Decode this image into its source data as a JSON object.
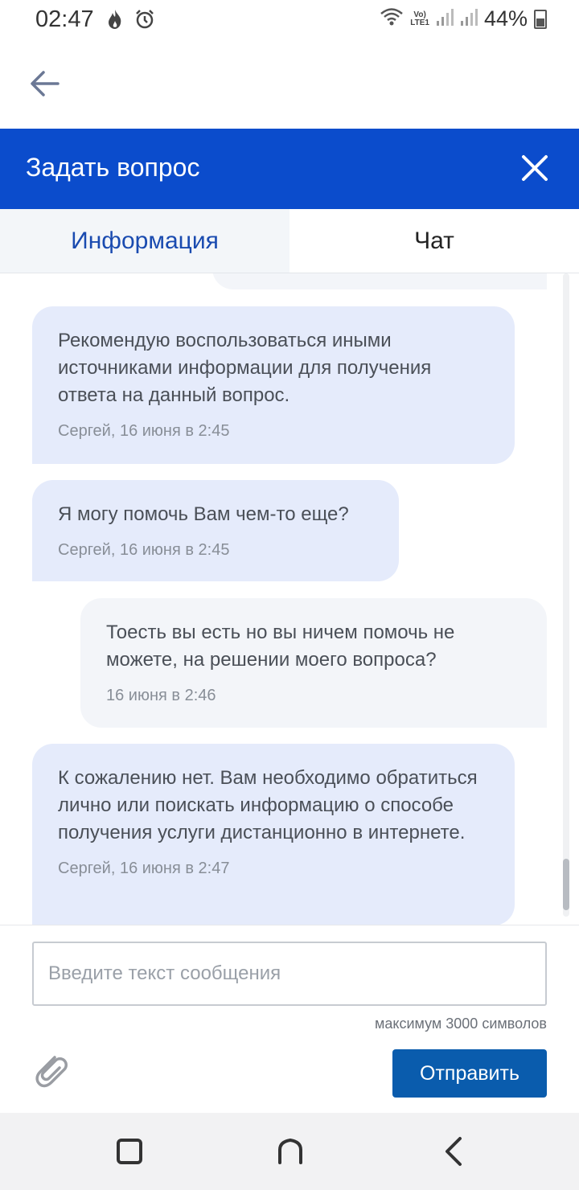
{
  "status_bar": {
    "time": "02:47",
    "battery": "44%",
    "network_label_top": "Vo)",
    "network_label_bottom": "LTE1",
    "icons": [
      "flame-icon",
      "alarm-icon",
      "wifi-icon",
      "signal-icon",
      "battery-icon"
    ]
  },
  "header": {
    "title": "Задать вопрос",
    "background_color": "#0b4ccc"
  },
  "tabs": [
    {
      "label": "Информация",
      "active": false
    },
    {
      "label": "Чат",
      "active": true
    }
  ],
  "messages": [
    {
      "from": "operator",
      "text": "Рекомендую воспользоваться иными источниками информации для получения ответа на данный вопрос.",
      "meta": "Сергей, 16 июня в 2:45"
    },
    {
      "from": "operator",
      "text": "Я могу помочь Вам чем-то еще?",
      "meta": "Сергей, 16 июня в 2:45"
    },
    {
      "from": "user",
      "text": "Тоесть вы есть но вы ничем помочь не можете, на решении моего вопроса?",
      "meta": "16 июня в 2:46"
    },
    {
      "from": "operator",
      "text": "К сожалению нет. Вам необходимо обратиться лично или поискать информацию о способе получения услуги дистанционно в интернете.",
      "meta": "Сергей, 16 июня в 2:47"
    }
  ],
  "composer": {
    "placeholder": "Введите текст сообщения",
    "value": "",
    "max_chars_label": "максимум 3000 символов",
    "send_label": "Отправить"
  },
  "colors": {
    "accent": "#0b4ccc",
    "send_button": "#0a5cad",
    "operator_bubble": "#e5ebfb",
    "user_bubble": "#f3f5f9"
  }
}
